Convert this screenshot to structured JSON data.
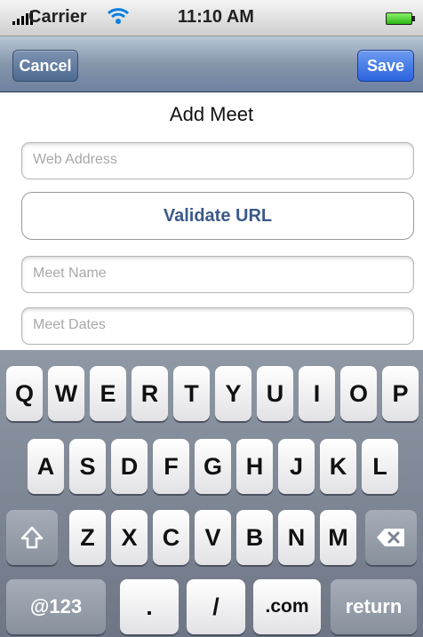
{
  "status_bar": {
    "carrier": "Carrier",
    "time": "11:10 AM",
    "signal_icon": "signal-bars",
    "wifi_icon": "wifi",
    "battery_icon": "battery-full"
  },
  "nav": {
    "cancel_label": "Cancel",
    "save_label": "Save"
  },
  "form": {
    "title": "Add Meet",
    "web_address_placeholder": "Web Address",
    "validate_label": "Validate URL",
    "meet_name_placeholder": "Meet Name",
    "meet_dates_placeholder": "Meet Dates"
  },
  "keyboard": {
    "row1": [
      "Q",
      "W",
      "E",
      "R",
      "T",
      "Y",
      "U",
      "I",
      "O",
      "P"
    ],
    "row2": [
      "A",
      "S",
      "D",
      "F",
      "G",
      "H",
      "J",
      "K",
      "L"
    ],
    "row3": [
      "Z",
      "X",
      "C",
      "V",
      "B",
      "N",
      "M"
    ],
    "shift_icon": "shift-arrow",
    "delete_icon": "backspace",
    "numbers_label": "@123",
    "period_label": ".",
    "slash_label": "/",
    "dotcom_label": ".com",
    "return_label": "return"
  },
  "colors": {
    "accent": "#2a63de",
    "nav_bar": "#8596ab",
    "validate_text": "#3b5a89"
  }
}
